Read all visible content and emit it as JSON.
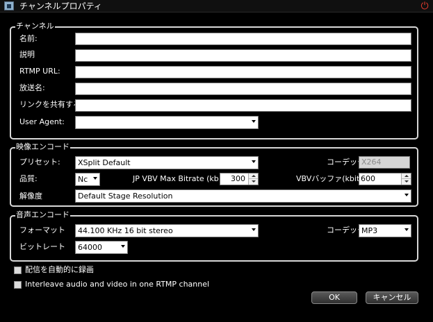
{
  "window": {
    "title": "チャンネルプロパティ"
  },
  "channel": {
    "legend": "チャンネル",
    "name_label": "名前:",
    "name_value": "",
    "description_label": "説明",
    "description_value": "",
    "rtmp_label": "RTMP URL:",
    "rtmp_value": "",
    "stream_name_label": "放送名:",
    "stream_name_value": "",
    "share_link_label": "リンクを共有する:",
    "share_link_value": "",
    "user_agent_label": "User Agent:",
    "user_agent_value": ""
  },
  "video": {
    "legend": "映像エンコード",
    "preset_label": "プリセット:",
    "preset_value": "XSplit Default",
    "codec_label": "コーデック",
    "codec_value": "X264",
    "quality_label": "品質:",
    "quality_value": "Nc",
    "max_bitrate_label": "JP VBV Max Bitrate (kb",
    "max_bitrate_value": "300",
    "vbv_buffer_label": "VBVバッファ(kbit)",
    "vbv_buffer_value": "600",
    "resolution_label": "解像度",
    "resolution_value": "Default Stage Resolution"
  },
  "audio": {
    "legend": "音声エンコード",
    "format_label": "フォーマット",
    "format_value": "44.100 KHz 16 bit stereo",
    "codec_label": "コーデック",
    "codec_value": "MP3",
    "bitrate_label": "ビットレート",
    "bitrate_value": "64000"
  },
  "options": {
    "auto_record_label": "配信を自動的に録画",
    "auto_record_checked": false,
    "interleave_label": "Interleave audio and video in one RTMP channel",
    "interleave_checked": false
  },
  "buttons": {
    "ok": "OK",
    "cancel": "キャンセル"
  },
  "icons": {
    "app": "app-icon",
    "power": "power-icon",
    "dropdown": "chevron-down-icon"
  },
  "colors": {
    "background": "#000000",
    "group_border": "#d8d8d8",
    "power": "#e23a2c"
  }
}
